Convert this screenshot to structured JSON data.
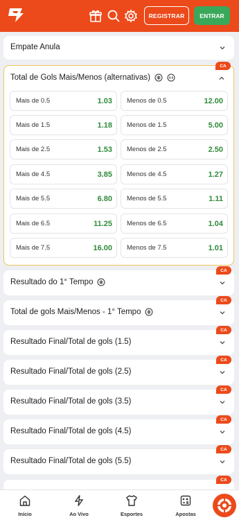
{
  "header": {
    "register_label": "REGISTRAR",
    "enter_label": "ENTRAR",
    "brand_color": "#ec4a1a",
    "enter_color": "#3aa85a"
  },
  "markets": {
    "empate": {
      "title": "Empate Anula"
    },
    "alternativas": {
      "title": "Total de Gols Mais/Menos (alternativas)",
      "badge": "CA",
      "odds": [
        {
          "over_label": "Mais de 0.5",
          "over_value": "1.03",
          "under_label": "Menos de 0.5",
          "under_value": "12.00"
        },
        {
          "over_label": "Mais de 1.5",
          "over_value": "1.18",
          "under_label": "Menos de 1.5",
          "under_value": "5.00"
        },
        {
          "over_label": "Mais de 2.5",
          "over_value": "1.53",
          "under_label": "Menos de 2.5",
          "under_value": "2.50"
        },
        {
          "over_label": "Mais de 4.5",
          "over_value": "3.85",
          "under_label": "Menos de 4.5",
          "under_value": "1.27"
        },
        {
          "over_label": "Mais de 5.5",
          "over_value": "6.80",
          "under_label": "Menos de 5.5",
          "under_value": "1.11"
        },
        {
          "over_label": "Mais de 6.5",
          "over_value": "11.25",
          "under_label": "Menos de 6.5",
          "under_value": "1.04"
        },
        {
          "over_label": "Mais de 7.5",
          "over_value": "16.00",
          "under_label": "Menos de 7.5",
          "under_value": "1.01"
        }
      ]
    },
    "collapsed": [
      {
        "title": "Resultado do 1° Tempo",
        "badge": "CA"
      },
      {
        "title": "Total de gols Mais/Menos - 1° Tempo",
        "badge": "CA"
      },
      {
        "title": "Resultado Final/Total de gols (1.5)",
        "badge": "CA"
      },
      {
        "title": "Resultado Final/Total de gols (2.5)",
        "badge": "CA"
      },
      {
        "title": "Resultado Final/Total de gols (3.5)",
        "badge": "CA"
      },
      {
        "title": "Resultado Final/Total de gols (4.5)",
        "badge": "CA"
      },
      {
        "title": "Resultado Final/Total de gols (5.5)",
        "badge": "CA"
      },
      {
        "title": "",
        "badge": "CA"
      }
    ]
  },
  "bottom_nav": [
    {
      "label": "Início",
      "icon": "home-icon"
    },
    {
      "label": "Ao Vivo",
      "icon": "live-icon"
    },
    {
      "label": "Esportes",
      "icon": "jersey-icon"
    },
    {
      "label": "Apostas",
      "icon": "bets-icon"
    }
  ]
}
